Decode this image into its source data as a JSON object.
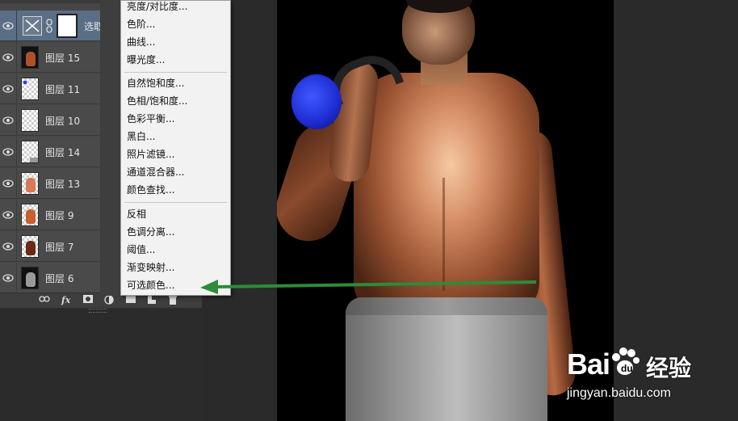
{
  "layers_panel": {
    "selected_layer": {
      "name": "选取"
    },
    "layers": [
      {
        "name": "图层 15",
        "thumb": "dark-figure"
      },
      {
        "name": "图层 11",
        "thumb": "transparent"
      },
      {
        "name": "图层 10",
        "thumb": "transparent"
      },
      {
        "name": "图层 14",
        "thumb": "transparent"
      },
      {
        "name": "图层 13",
        "thumb": "orange-figure"
      },
      {
        "name": "图层 9",
        "thumb": "orange-figure"
      },
      {
        "name": "图层 7",
        "thumb": "dark-figure"
      },
      {
        "name": "图层 6",
        "thumb": "grey-figure"
      }
    ],
    "bottom_icons": [
      "link-icon",
      "fx-icon",
      "mask-icon",
      "adjustment-icon",
      "group-icon",
      "new-layer-icon",
      "trash-icon"
    ],
    "fx_label": "fx"
  },
  "adjust_menu": {
    "group1": [
      "亮度/对比度...",
      "色阶...",
      "曲线...",
      "曝光度..."
    ],
    "group2": [
      "自然饱和度...",
      "色相/饱和度...",
      "色彩平衡...",
      "黑白...",
      "照片滤镜...",
      "通道混合器...",
      "颜色查找..."
    ],
    "group3": [
      "反相",
      "色调分离...",
      "阈值...",
      "渐变映射...",
      "可选颜色..."
    ]
  },
  "annotation": {
    "arrow_color": "#2e8b3a",
    "points_to": "可选颜色..."
  },
  "watermark": {
    "brand": "Bai",
    "brand_cn": "经验",
    "url": "jingyan.baidu.com"
  },
  "colors": {
    "panel_bg": "#464646",
    "selected_row": "#5a6e86",
    "menu_bg": "#f2f2f2",
    "canvas_bg": "#000000"
  }
}
